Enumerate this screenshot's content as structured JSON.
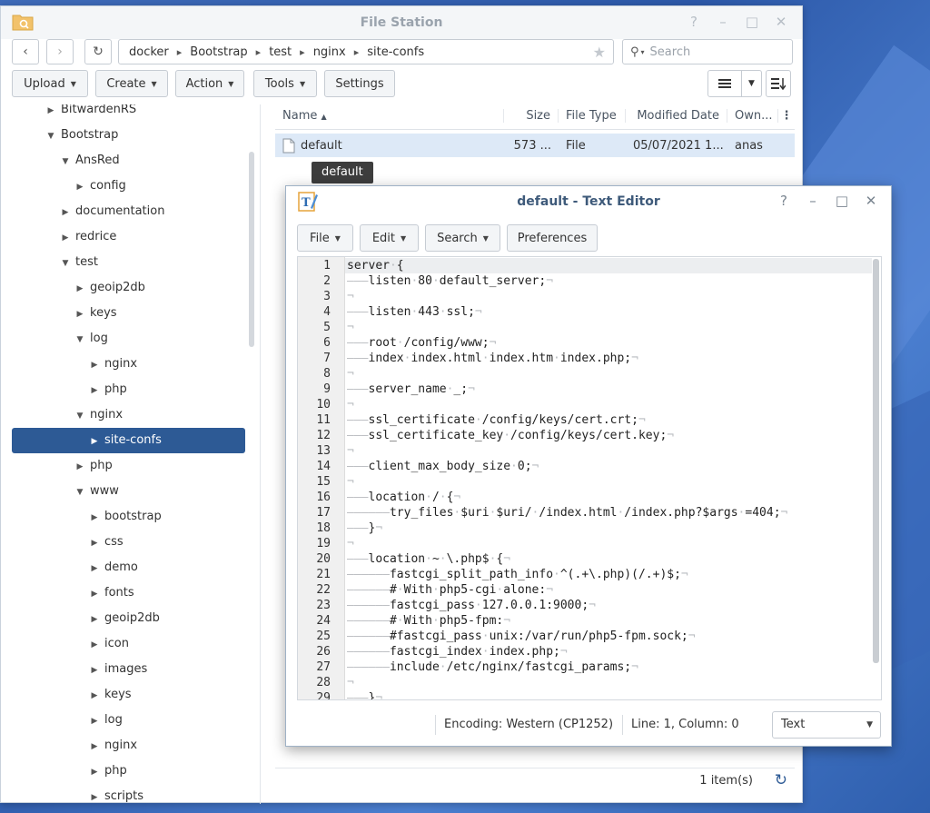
{
  "file_station": {
    "title": "File Station",
    "window_controls": [
      "?",
      "–",
      "□",
      "✕"
    ],
    "breadcrumb": [
      "docker",
      "Bootstrap",
      "test",
      "nginx",
      "site-confs"
    ],
    "search_placeholder": "Search",
    "toolbar": {
      "upload": "Upload",
      "create": "Create",
      "action": "Action",
      "tools": "Tools",
      "settings": "Settings"
    },
    "tree": [
      {
        "label": "BitwardenRS",
        "level": 1,
        "state": "collapsed"
      },
      {
        "label": "Bootstrap",
        "level": 1,
        "state": "expanded"
      },
      {
        "label": "AnsRed",
        "level": 2,
        "state": "expanded"
      },
      {
        "label": "config",
        "level": 3,
        "state": "collapsed"
      },
      {
        "label": "documentation",
        "level": 2,
        "state": "collapsed"
      },
      {
        "label": "redrice",
        "level": 2,
        "state": "collapsed"
      },
      {
        "label": "test",
        "level": 2,
        "state": "expanded"
      },
      {
        "label": "geoip2db",
        "level": 3,
        "state": "collapsed"
      },
      {
        "label": "keys",
        "level": 3,
        "state": "collapsed"
      },
      {
        "label": "log",
        "level": 3,
        "state": "expanded"
      },
      {
        "label": "nginx",
        "level": 4,
        "state": "collapsed"
      },
      {
        "label": "php",
        "level": 4,
        "state": "collapsed"
      },
      {
        "label": "nginx",
        "level": 3,
        "state": "expanded"
      },
      {
        "label": "site-confs",
        "level": 4,
        "state": "collapsed",
        "selected": true
      },
      {
        "label": "php",
        "level": 3,
        "state": "collapsed"
      },
      {
        "label": "www",
        "level": 3,
        "state": "expanded"
      },
      {
        "label": "bootstrap",
        "level": 4,
        "state": "collapsed"
      },
      {
        "label": "css",
        "level": 4,
        "state": "collapsed"
      },
      {
        "label": "demo",
        "level": 4,
        "state": "collapsed"
      },
      {
        "label": "fonts",
        "level": 4,
        "state": "collapsed"
      },
      {
        "label": "geoip2db",
        "level": 4,
        "state": "collapsed"
      },
      {
        "label": "icon",
        "level": 4,
        "state": "collapsed"
      },
      {
        "label": "images",
        "level": 4,
        "state": "collapsed"
      },
      {
        "label": "keys",
        "level": 4,
        "state": "collapsed"
      },
      {
        "label": "log",
        "level": 4,
        "state": "collapsed"
      },
      {
        "label": "nginx",
        "level": 4,
        "state": "collapsed"
      },
      {
        "label": "php",
        "level": 4,
        "state": "collapsed"
      },
      {
        "label": "scripts",
        "level": 4,
        "state": "collapsed"
      }
    ],
    "columns": {
      "name": "Name",
      "size": "Size",
      "file_type": "File Type",
      "modified_date": "Modified Date",
      "owner": "Own..."
    },
    "files": [
      {
        "name": "default",
        "size": "573 ...",
        "type": "File",
        "modified": "05/07/2021 1...",
        "owner": "anas"
      }
    ],
    "tooltip": "default",
    "item_count": "1 item(s)"
  },
  "text_editor": {
    "title": "default - Text Editor",
    "window_controls": [
      "?",
      "–",
      "□",
      "✕"
    ],
    "menu": {
      "file": "File",
      "edit": "Edit",
      "search": "Search",
      "preferences": "Preferences"
    },
    "lines": [
      "server·{",
      "———listen·80·default_server;¬",
      "¬",
      "———listen·443·ssl;¬",
      "¬",
      "———root·/config/www;¬",
      "———index·index.html·index.htm·index.php;¬",
      "¬",
      "———server_name·_;¬",
      "¬",
      "———ssl_certificate·/config/keys/cert.crt;¬",
      "———ssl_certificate_key·/config/keys/cert.key;¬",
      "¬",
      "———client_max_body_size·0;¬",
      "¬",
      "———location·/·{¬",
      "——————try_files·$uri·$uri/·/index.html·/index.php?$args·=404;¬",
      "———}¬",
      "¬",
      "———location·~·\\.php$·{¬",
      "——————fastcgi_split_path_info·^(.+\\.php)(/.+)$;¬",
      "——————#·With·php5-cgi·alone:¬",
      "——————fastcgi_pass·127.0.0.1:9000;¬",
      "——————#·With·php5-fpm:¬",
      "——————#fastcgi_pass·unix:/var/run/php5-fpm.sock;¬",
      "——————fastcgi_index·index.php;¬",
      "——————include·/etc/nginx/fastcgi_params;¬",
      "¬",
      "———}¬"
    ],
    "encoding": "Encoding: Western (CP1252)",
    "position": "Line: 1, Column: 0",
    "mode": "Text"
  }
}
